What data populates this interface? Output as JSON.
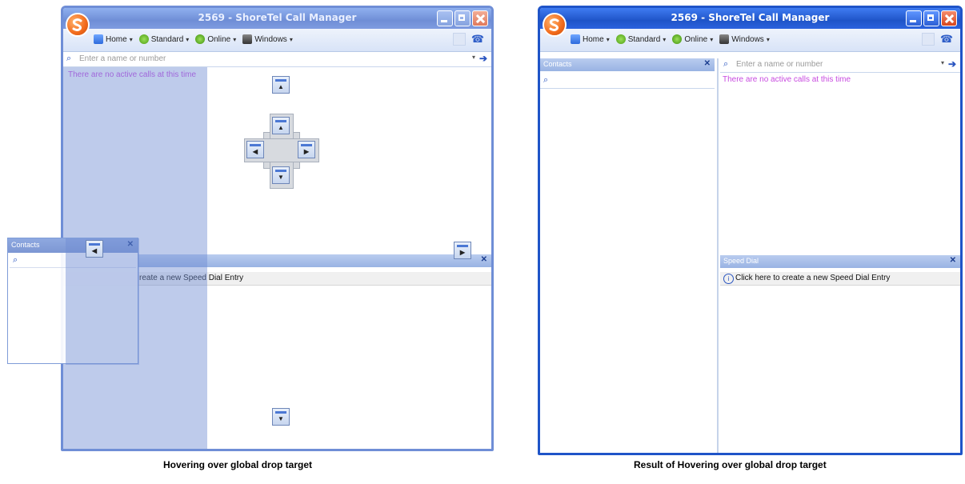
{
  "left": {
    "title": "2569 - ShoreTel Call Manager",
    "menu": [
      "Home",
      "Standard",
      "Online",
      "Windows"
    ],
    "search_placeholder": "Enter a name or number",
    "no_calls": "There are no active calls at this time",
    "speed_dial_entry": "reate a new Speed Dial Entry",
    "floating_panel_title": "Contacts",
    "caption": "Hovering over global drop target"
  },
  "right": {
    "title": "2569 - ShoreTel Call Manager",
    "menu": [
      "Home",
      "Standard",
      "Online",
      "Windows"
    ],
    "contacts_title": "Contacts",
    "search_placeholder": "Enter a name or number",
    "no_calls": "There are no active calls at this time",
    "speed_dial_title": "Speed Dial",
    "speed_dial_entry": "Click here to create a new Speed Dial Entry",
    "caption": "Result of Hovering over global drop target"
  },
  "icons": {
    "dropdown_caret": "▾",
    "close_x": "✕",
    "go_arrow": "➔",
    "search": "⌕",
    "phone": "☎",
    "info": "i",
    "dock_up": "▲",
    "dock_down": "▼",
    "dock_left": "◀",
    "dock_right": "▶"
  }
}
